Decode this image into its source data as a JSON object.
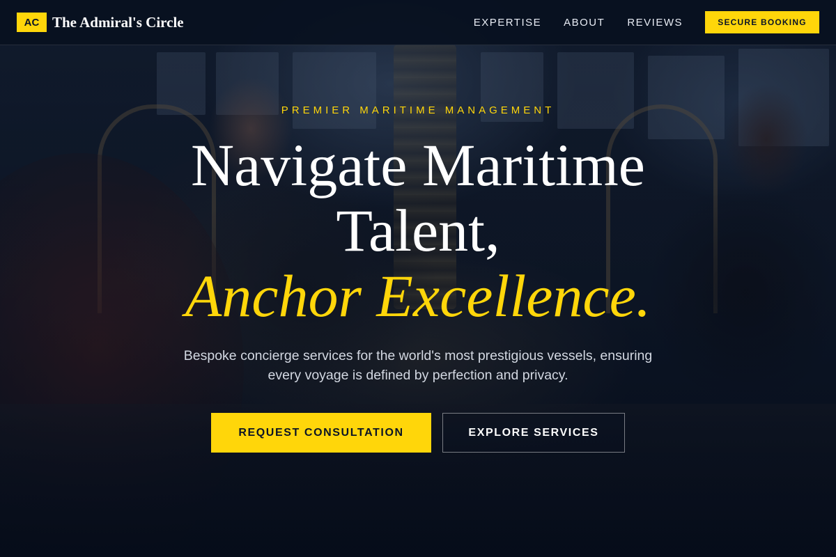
{
  "brand": {
    "mark": "AC",
    "name": "The Admiral's Circle"
  },
  "nav": {
    "links": [
      "EXPERTISE",
      "ABOUT",
      "REVIEWS"
    ],
    "cta_label": "SECURE BOOKING"
  },
  "hero": {
    "eyebrow": "PREMIER MARITIME MANAGEMENT",
    "headline_line1": "Navigate Maritime",
    "headline_line2": "Talent,",
    "headline_accent": "Anchor Excellence.",
    "subtitle": "Bespoke concierge services for the world's most prestigious vessels, ensuring every voyage is defined by perfection and privacy.",
    "primary_button": "REQUEST CONSULTATION",
    "secondary_button": "EXPLORE SERVICES"
  },
  "colors": {
    "accent": "#ffd60a",
    "navy": "#081222",
    "text_light": "#ffffff"
  }
}
